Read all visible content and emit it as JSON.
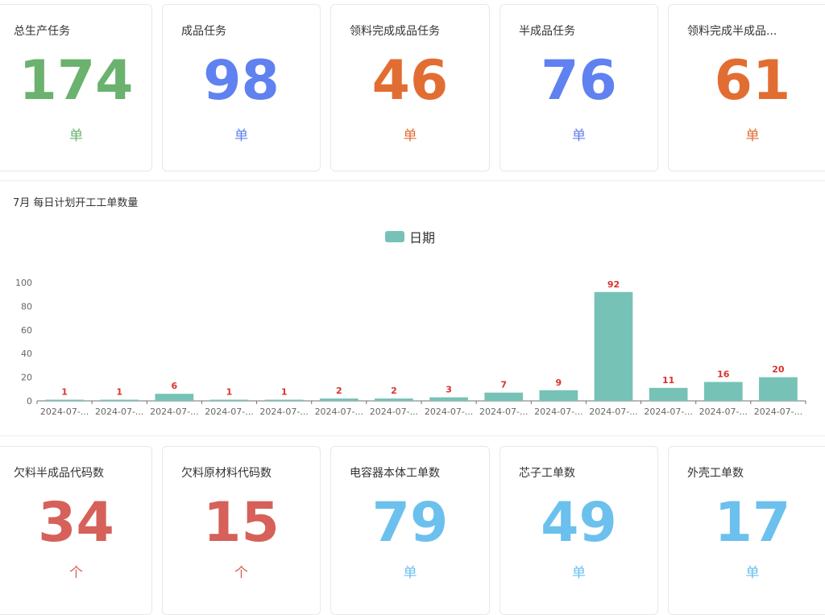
{
  "top_cards": [
    {
      "title": "总生产任务",
      "value": "174",
      "unit": "单",
      "color": "#6ab26e"
    },
    {
      "title": "成品任务",
      "value": "98",
      "unit": "单",
      "color": "#6081f0"
    },
    {
      "title": "领料完成成品任务",
      "value": "46",
      "unit": "单",
      "color": "#e26d32"
    },
    {
      "title": "半成品任务",
      "value": "76",
      "unit": "单",
      "color": "#6081f0"
    },
    {
      "title": "领料完成半成品...",
      "value": "61",
      "unit": "单",
      "color": "#e26d32"
    }
  ],
  "bottom_cards": [
    {
      "title": "欠料半成品代码数",
      "value": "34",
      "unit": "个",
      "color": "#d6615a"
    },
    {
      "title": "欠料原材料代码数",
      "value": "15",
      "unit": "个",
      "color": "#d6615a"
    },
    {
      "title": "电容器本体工单数",
      "value": "79",
      "unit": "单",
      "color": "#6cc0ee"
    },
    {
      "title": "芯子工单数",
      "value": "49",
      "unit": "单",
      "color": "#6cc0ee"
    },
    {
      "title": "外壳工单数",
      "value": "17",
      "unit": "单",
      "color": "#6cc0ee"
    }
  ],
  "chart_title": "7月 每日计划开工工单数量",
  "chart_data": {
    "type": "bar",
    "title": "7月 每日计划开工工单数量",
    "categories": [
      "2024-07-...",
      "2024-07-...",
      "2024-07-...",
      "2024-07-...",
      "2024-07-...",
      "2024-07-...",
      "2024-07-...",
      "2024-07-...",
      "2024-07-...",
      "2024-07-...",
      "2024-07-...",
      "2024-07-...",
      "2024-07-...",
      "2024-07-..."
    ],
    "series": [
      {
        "name": "日期",
        "values": [
          1,
          1,
          6,
          1,
          1,
          2,
          2,
          3,
          7,
          9,
          92,
          11,
          16,
          20
        ]
      }
    ],
    "yticks": [
      0,
      20,
      40,
      60,
      80,
      100
    ],
    "ylim": [
      0,
      100
    ],
    "bar_color": "#76c2b6",
    "label_color": "#d9322e",
    "legend": "top-center",
    "grid": false
  }
}
